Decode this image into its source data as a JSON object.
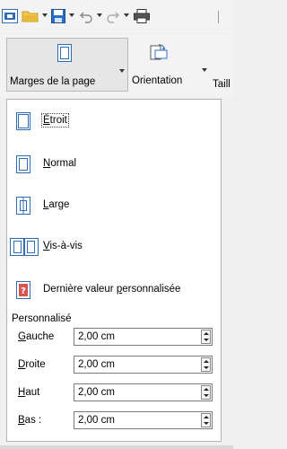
{
  "toolbar": {
    "icons": [
      "new-document-icon",
      "open-folder-icon",
      "save-icon",
      "undo-icon",
      "redo-icon",
      "print-icon"
    ]
  },
  "ribbon": {
    "margins_label": "Marges de la page",
    "orientation_label": "Orientation",
    "size_label": "Taill"
  },
  "menu": {
    "items": [
      {
        "label": "Étroit",
        "accent": "É",
        "rest": "troit",
        "icon": "narrow-margins-icon"
      },
      {
        "label": "Normal",
        "accent": "N",
        "rest": "ormal",
        "icon": "normal-margins-icon"
      },
      {
        "label": "Large",
        "accent": "L",
        "rest": "arge",
        "icon": "wide-margins-icon"
      },
      {
        "label": "Vis-à-vis",
        "accent": "V",
        "rest": "is-à-vis",
        "icon": "mirrored-margins-icon"
      },
      {
        "label": "Dernière valeur personnalisée",
        "pre": "Dernière valeur ",
        "accent": "p",
        "rest": "ersonnalisée",
        "icon": "last-custom-value-icon"
      }
    ],
    "custom_title": "Personnalisé",
    "fields": [
      {
        "accent": "G",
        "rest": "auche",
        "value": "2,00 cm"
      },
      {
        "accent": "D",
        "rest": "roite",
        "value": "2,00 cm"
      },
      {
        "accent": "H",
        "rest": "aut",
        "value": "2,00 cm"
      },
      {
        "accent": "B",
        "rest": "as :",
        "value": "2,00 cm"
      }
    ]
  },
  "colors": {
    "accent_blue": "#2f6db5",
    "folder_yellow": "#e8b83a",
    "save_blue": "#2a6ec8",
    "print_dark": "#333333",
    "dialog_red": "#d9534f"
  }
}
